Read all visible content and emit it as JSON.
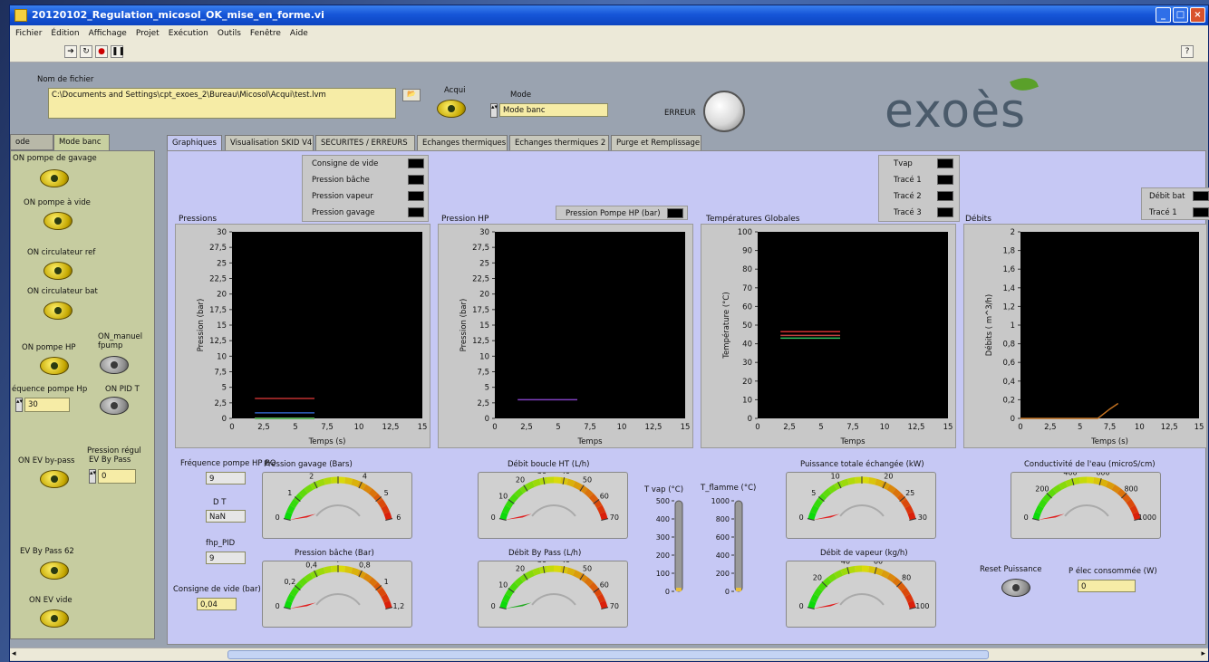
{
  "window": {
    "title": "20120102_Regulation_micosol_OK_mise_en_forme.vi"
  },
  "menu": [
    "Fichier",
    "Édition",
    "Affichage",
    "Projet",
    "Exécution",
    "Outils",
    "Fenêtre",
    "Aide"
  ],
  "file": {
    "label": "Nom de fichier",
    "path": "C:\\Documents and Settings\\cpt_exoes_2\\Bureau\\Micosol\\Acqui\\test.lvm"
  },
  "acqui_label": "Acqui",
  "mode": {
    "label": "Mode",
    "value": "Mode banc"
  },
  "erreur_label": "ERREUR",
  "logo": "exoès",
  "left_tabs": [
    "ode auto",
    "Mode banc"
  ],
  "left": {
    "on_pompe_gavage": "ON pompe de gavage",
    "on_pompe_vide": "ON pompe à vide",
    "on_circ_ref": "ON circulateur ref",
    "on_circ_bat": "ON circulateur bat",
    "on_pompe_hp": "ON pompe HP",
    "on_manuel": "ON_manuel",
    "fpump": "fpump",
    "freq_pompe_label": "équence pompe Hp",
    "freq_pompe_value": "30",
    "on_pid_t": "ON PID T",
    "on_ev_bypass": "ON EV by-pass",
    "pression_regul": "Pression régul",
    "ev_by_pass": "EV By Pass",
    "pression_regul_value": "0",
    "ev_by_pass_62": "EV By Pass 62",
    "on_ev_vide": "ON EV vide"
  },
  "tabs": [
    "Graphiques",
    "Visualisation SKID V4",
    "SECURITES / ERREURS",
    "Echanges thermiques",
    "Echanges thermiques 2",
    "Purge et Remplissage"
  ],
  "charts": {
    "pressions": {
      "title": "Pressions",
      "ylabel": "Pression (bar)",
      "xlabel": "Temps (s)",
      "legend": [
        "Consigne de vide",
        "Pression bâche",
        "Pression vapeur",
        "Pression gavage"
      ]
    },
    "hp": {
      "title": "Pression HP",
      "ylabel": "Pression (bar)",
      "xlabel": "Temps",
      "legend": [
        "Pression Pompe HP (bar)"
      ]
    },
    "temp": {
      "title": "Températures Globales",
      "ylabel": "Température (°C)",
      "xlabel": "Temps",
      "legend": [
        "Tvap",
        "Tracé 1",
        "Tracé 2",
        "Tracé 3"
      ]
    },
    "debits": {
      "title": "Débits",
      "ylabel": "Débits ( m^3/h)",
      "xlabel": "Temps (s)",
      "legend": [
        "Débit bat",
        "Tracé 1"
      ]
    }
  },
  "chart_data": [
    {
      "type": "line",
      "title": "Pressions",
      "ylabel": "Pression (bar)",
      "xlabel": "Temps (s)",
      "xlim": [
        0,
        15
      ],
      "ylim": [
        0,
        30
      ],
      "xticks": [
        "0",
        "2,5",
        "5",
        "7,5",
        "10",
        "12,5",
        "15"
      ],
      "yticks": [
        "0",
        "2,5",
        "5",
        "7,5",
        "10",
        "12,5",
        "15",
        "17,5",
        "20",
        "22,5",
        "25",
        "27,5",
        "30"
      ],
      "series": [
        {
          "name": "Pression vapeur",
          "color": "#c03030",
          "x": [
            1.8,
            6.5
          ],
          "y": [
            3.2,
            3.2
          ]
        },
        {
          "name": "Pression bâche",
          "color": "#3060c0",
          "x": [
            1.8,
            6.5
          ],
          "y": [
            0.9,
            0.9
          ]
        },
        {
          "name": "Consigne de vide",
          "color": "#e0e0e0",
          "x": [
            1.8,
            6.5
          ],
          "y": [
            0.04,
            0.04
          ]
        },
        {
          "name": "Pression gavage",
          "color": "#30a030",
          "x": [
            1.8,
            6.5
          ],
          "y": [
            0.0,
            0.0
          ]
        }
      ]
    },
    {
      "type": "line",
      "title": "Pression HP",
      "ylabel": "Pression (bar)",
      "xlabel": "Temps",
      "xlim": [
        0,
        15
      ],
      "ylim": [
        0,
        30
      ],
      "xticks": [
        "0",
        "2,5",
        "5",
        "7,5",
        "10",
        "12,5",
        "15"
      ],
      "yticks": [
        "0",
        "2,5",
        "5",
        "7,5",
        "10",
        "12,5",
        "15",
        "17,5",
        "20",
        "22,5",
        "25",
        "27,5",
        "30"
      ],
      "series": [
        {
          "name": "Pression Pompe HP (bar)",
          "color": "#8040c0",
          "x": [
            1.8,
            6.5
          ],
          "y": [
            3.0,
            3.0
          ]
        }
      ]
    },
    {
      "type": "line",
      "title": "Températures Globales",
      "ylabel": "Température (°C)",
      "xlabel": "Temps",
      "xlim": [
        0,
        15
      ],
      "ylim": [
        0,
        100
      ],
      "xticks": [
        "0",
        "2,5",
        "5",
        "7,5",
        "10",
        "12,5",
        "15"
      ],
      "yticks": [
        "0",
        "10",
        "20",
        "30",
        "40",
        "50",
        "60",
        "70",
        "80",
        "90",
        "100"
      ],
      "series": [
        {
          "name": "Tvap",
          "color": "#d03030",
          "x": [
            1.8,
            6.5
          ],
          "y": [
            46.5,
            46.5
          ]
        },
        {
          "name": "Tracé 1",
          "color": "#c04040",
          "x": [
            1.8,
            6.5
          ],
          "y": [
            44.5,
            44.5
          ]
        },
        {
          "name": "Tracé 2",
          "color": "#30c060",
          "x": [
            1.8,
            6.5
          ],
          "y": [
            43.0,
            43.0
          ]
        }
      ]
    },
    {
      "type": "line",
      "title": "Débits",
      "ylabel": "Débits ( m^3/h)",
      "xlabel": "Temps (s)",
      "xlim": [
        0,
        15
      ],
      "ylim": [
        0,
        2
      ],
      "xticks": [
        "0",
        "2,5",
        "5",
        "7,5",
        "10",
        "12,5",
        "15"
      ],
      "yticks": [
        "0",
        "0,2",
        "0,4",
        "0,6",
        "0,8",
        "1",
        "1,2",
        "1,4",
        "1,6",
        "1,8",
        "2"
      ],
      "series": [
        {
          "name": "Débit bat",
          "color": "#c07020",
          "x": [
            0,
            6.5,
            7.5,
            8.2
          ],
          "y": [
            0,
            0,
            0.1,
            0.16
          ]
        }
      ]
    }
  ],
  "bottom": {
    "freq_bo_label": "Fréquence pompe HP BO",
    "freq_bo_value": "9",
    "dt_label": "D T",
    "dt_value": "NaN",
    "fhp_label": "fhp_PID",
    "fhp_value": "9",
    "consigne_label": "Consigne de vide (bar)",
    "consigne_value": "0,04",
    "tvap_label": "T vap (°C)",
    "tflamme_label": "T_flamme (°C)",
    "reset_label": "Reset Puissance",
    "pelec_label": "P élec consommée (W)",
    "pelec_value": "0"
  },
  "gauges": [
    {
      "id": "g1",
      "title": "Pression gavage (Bars)",
      "min": 0,
      "max": 6,
      "ticks": [
        "0",
        "1",
        "2",
        "3",
        "4",
        "5",
        "6"
      ],
      "value": 0
    },
    {
      "id": "g2",
      "title": "Pression bâche (Bar)",
      "min": 0,
      "max": 1.2,
      "ticks": [
        "0",
        "0,2",
        "0,4",
        "0,6",
        "0,8",
        "1",
        "1,2"
      ],
      "value": 0
    },
    {
      "id": "g3",
      "title": "Débit boucle HT (L/h)",
      "min": 0,
      "max": 70,
      "ticks": [
        "0",
        "10",
        "20",
        "30",
        "40",
        "50",
        "60",
        "70"
      ],
      "value": 0
    },
    {
      "id": "g4",
      "title": "Débit By Pass (L/h)",
      "min": 0,
      "max": 70,
      "ticks": [
        "0",
        "10",
        "20",
        "30",
        "40",
        "50",
        "60",
        "70"
      ],
      "value": 0
    },
    {
      "id": "g5",
      "title": "Puissance totale échangée (kW)",
      "min": 0,
      "max": 30,
      "ticks": [
        "0",
        "5",
        "10",
        "15",
        "20",
        "25",
        "30"
      ],
      "value": 0
    },
    {
      "id": "g6",
      "title": "Débit de vapeur (kg/h)",
      "min": 0,
      "max": 100,
      "ticks": [
        "0",
        "20",
        "40",
        "60",
        "80",
        "100"
      ],
      "value": 0
    },
    {
      "id": "g7",
      "title": "Conductivité de l'eau (microS/cm)",
      "min": 0,
      "max": 1000,
      "ticks": [
        "0",
        "200",
        "400",
        "600",
        "800",
        "1000"
      ],
      "value": 0
    }
  ],
  "thermo_tvap": {
    "ticks": [
      "0",
      "100",
      "200",
      "300",
      "400",
      "500"
    ],
    "fill": 0.02
  },
  "thermo_tflamme": {
    "ticks": [
      "0",
      "200",
      "400",
      "600",
      "800",
      "1000"
    ],
    "fill": 0.02
  }
}
